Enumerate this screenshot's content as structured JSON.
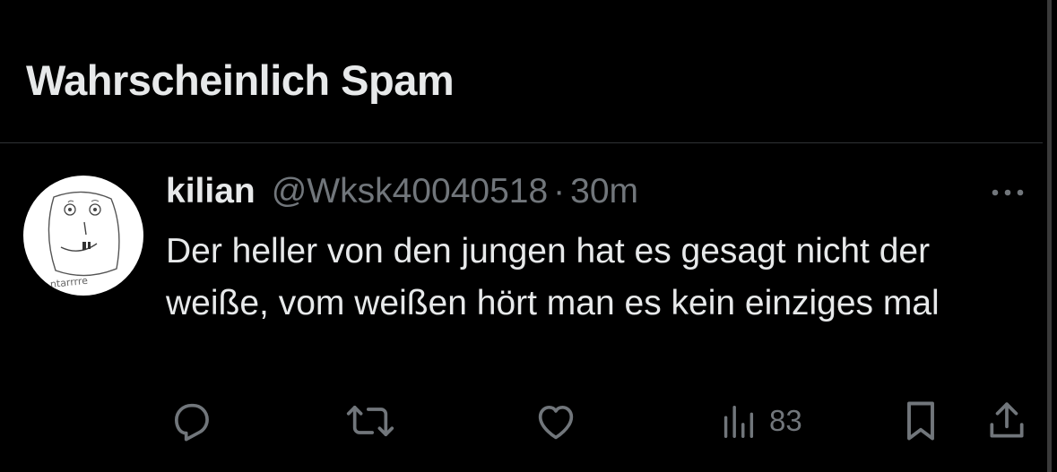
{
  "section": {
    "title": "Wahrscheinlich Spam"
  },
  "tweet": {
    "display_name": "kilian",
    "handle": "@Wksk40040518",
    "separator": "·",
    "time": "30m",
    "text": "Der heller von den jungen hat es gesagt nicht der weiße, vom weißen hört man es kein einziges mal",
    "avatar_scribble_text": "ntarrrre",
    "avatar_icon": "hand-drawn-face-avatar",
    "more_icon": "more-horizontal-icon",
    "actions": {
      "reply_icon": "reply-icon",
      "retweet_icon": "retweet-icon",
      "like_icon": "like-icon",
      "views_icon": "views-icon",
      "views_count": "83",
      "bookmark_icon": "bookmark-icon",
      "share_icon": "share-icon"
    }
  },
  "colors": {
    "background": "#000000",
    "primary_text": "#e7e9ea",
    "secondary_text": "#71767b",
    "divider": "#2f3336"
  }
}
